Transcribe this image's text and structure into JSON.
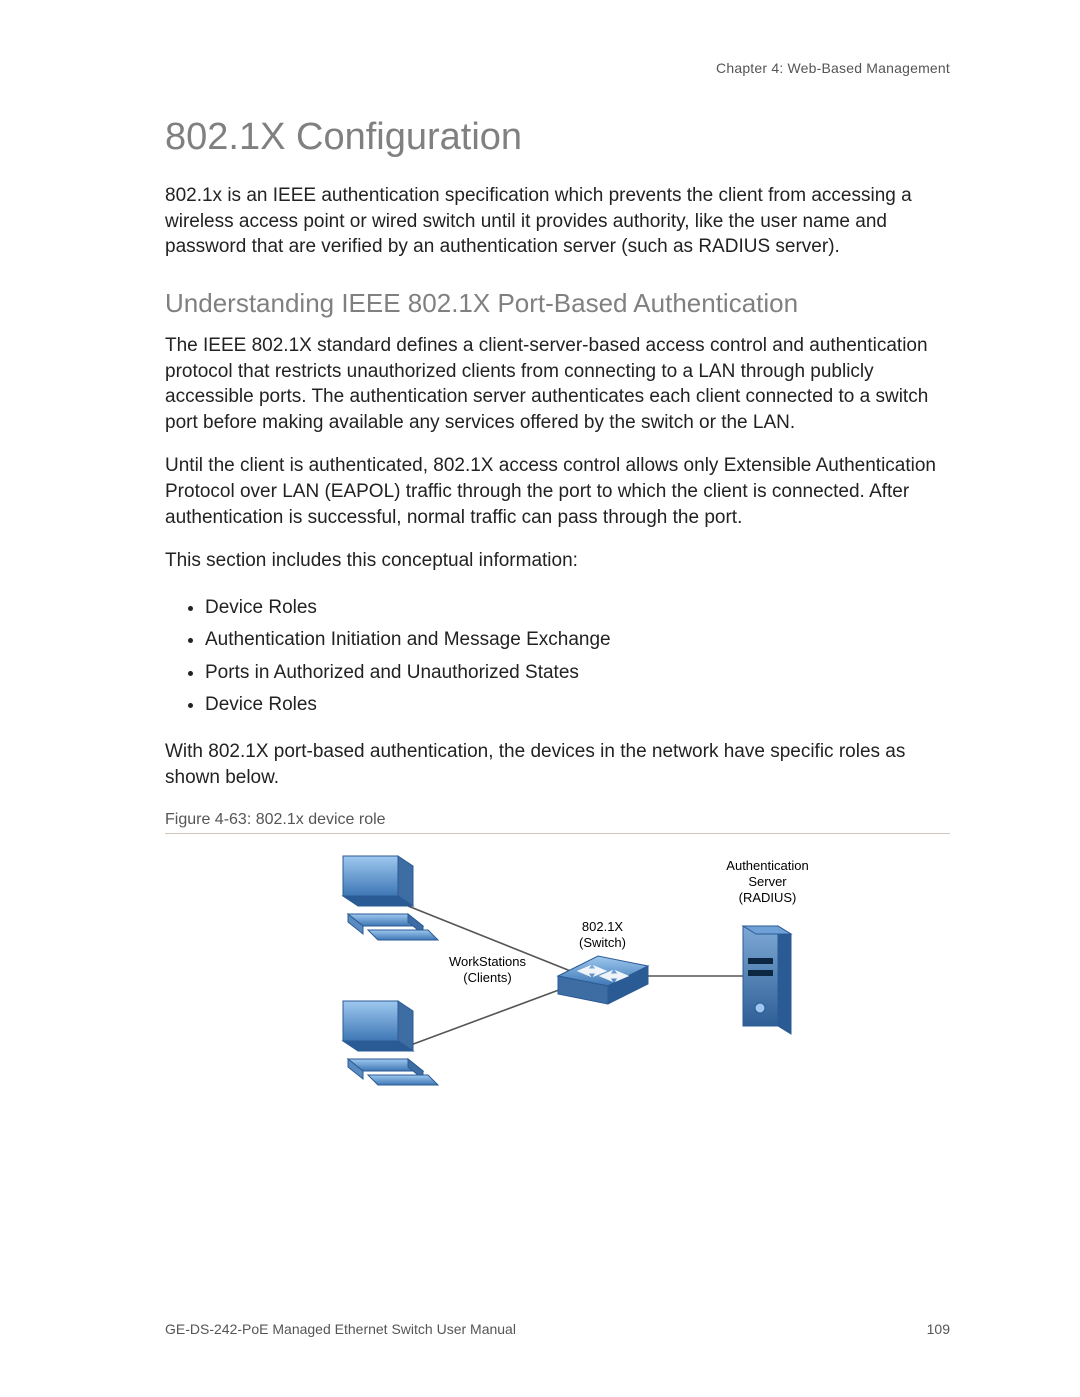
{
  "header": {
    "chapter": "Chapter 4: Web-Based Management"
  },
  "title": "802.1X Configuration",
  "intro_para": "802.1x is an IEEE authentication specification which prevents the client from accessing a wireless access point or wired switch until it provides authority, like the user name and password that are verified by an authentication server (such as RADIUS server).",
  "subtitle": "Understanding IEEE 802.1X Port-Based Authentication",
  "para2": "The IEEE 802.1X standard defines a client-server-based access control and authentication protocol that restricts unauthorized clients from connecting to a LAN through publicly accessible ports. The authentication server authenticates each client connected to a switch port before making available any services offered by the switch or the LAN.",
  "para3": "Until the client is authenticated, 802.1X access control allows only Extensible Authentication Protocol over LAN (EAPOL) traffic through the port to which the client is connected. After authentication is successful, normal traffic can pass through the port.",
  "para4": "This section includes this conceptual information:",
  "bullets": [
    "Device Roles",
    "Authentication Initiation and Message Exchange",
    "Ports in Authorized and Unauthorized States",
    "Device Roles"
  ],
  "para5": "With 802.1X port-based authentication, the devices in the network have specific roles as shown below.",
  "figure": {
    "caption": "Figure 4-63: 802.1x device role",
    "labels": {
      "workstations": "WorkStations\n(Clients)",
      "switch": "802.1X\n(Switch)",
      "server": "Authentication\nServer\n(RADIUS)"
    }
  },
  "footer": {
    "manual": "GE-DS-242-PoE Managed Ethernet Switch User Manual",
    "page": "109"
  }
}
